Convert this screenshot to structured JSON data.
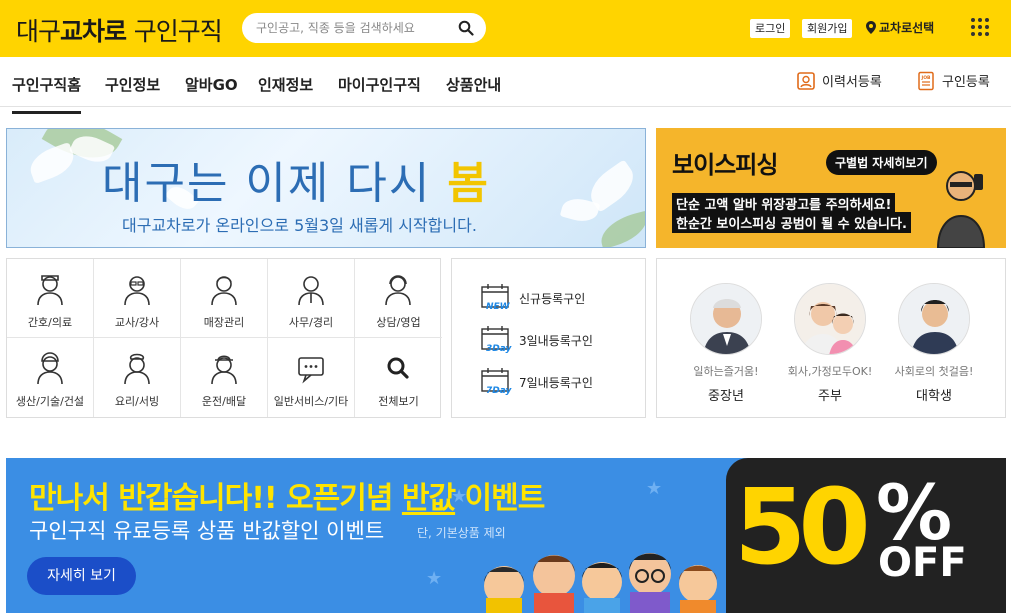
{
  "header": {
    "logo_region": "대구",
    "logo_brand": "교차로",
    "logo_service": "구인구직",
    "search_placeholder": "구인공고, 직종 등을 검색하세요",
    "login": "로그인",
    "signup": "회원가입",
    "region_select": "교차로선택",
    "brand_color": "#ffd400"
  },
  "nav": {
    "items": [
      "구인구직홈",
      "구인정보",
      "알바GO",
      "인재정보",
      "마이구인구직",
      "상품안내"
    ],
    "resume_register": "이력서등록",
    "job_register": "구인등록"
  },
  "banner_spring": {
    "headline": "대구는 이제 다시 ",
    "headline_accent": "봄",
    "subline": "대구교차로가 온라인으로 5월3일 새롭게 시작합니다."
  },
  "banner_voice": {
    "title": "보이스피싱",
    "pill": "구별법 자세히보기",
    "line1": "단순 고액 알바 위장광고를 주의하세요!",
    "line2": "한순간 보이스피싱 공범이 될 수 있습니다."
  },
  "categories": [
    {
      "label": "간호/의료",
      "icon": "nurse-icon"
    },
    {
      "label": "교사/강사",
      "icon": "teacher-icon"
    },
    {
      "label": "매장관리",
      "icon": "store-manager-icon"
    },
    {
      "label": "사무/경리",
      "icon": "office-worker-icon"
    },
    {
      "label": "상담/영업",
      "icon": "call-agent-icon"
    },
    {
      "label": "생산/기술/건설",
      "icon": "construction-worker-icon"
    },
    {
      "label": "요리/서빙",
      "icon": "chef-icon"
    },
    {
      "label": "운전/배달",
      "icon": "driver-icon"
    },
    {
      "label": "일반서비스/기타",
      "icon": "chat-bubble-icon"
    },
    {
      "label": "전체보기",
      "icon": "search-icon"
    }
  ],
  "recent": [
    {
      "tag": "NEW",
      "label": "신규등록구인"
    },
    {
      "tag": "3Day",
      "label": "3일내등록구인"
    },
    {
      "tag": "7Day",
      "label": "7일내등록구인"
    }
  ],
  "people": [
    {
      "caption": "일하는즐거움!",
      "name": "중장년"
    },
    {
      "caption": "회사,가정모두OK!",
      "name": "주부"
    },
    {
      "caption": "사회로의 첫걸음!",
      "name": "대학생"
    }
  ],
  "event": {
    "headline_a": "만나서 반갑습니다!! 오픈기념 ",
    "headline_b": "반값",
    "headline_c": " 이벤트",
    "sub": "구인구직 유료등록 상품 반값할인 이벤트",
    "note": "단, 기본상품 제외",
    "button": "자세히 보기",
    "big_number": "50",
    "percent": "%",
    "off": "OFF"
  }
}
